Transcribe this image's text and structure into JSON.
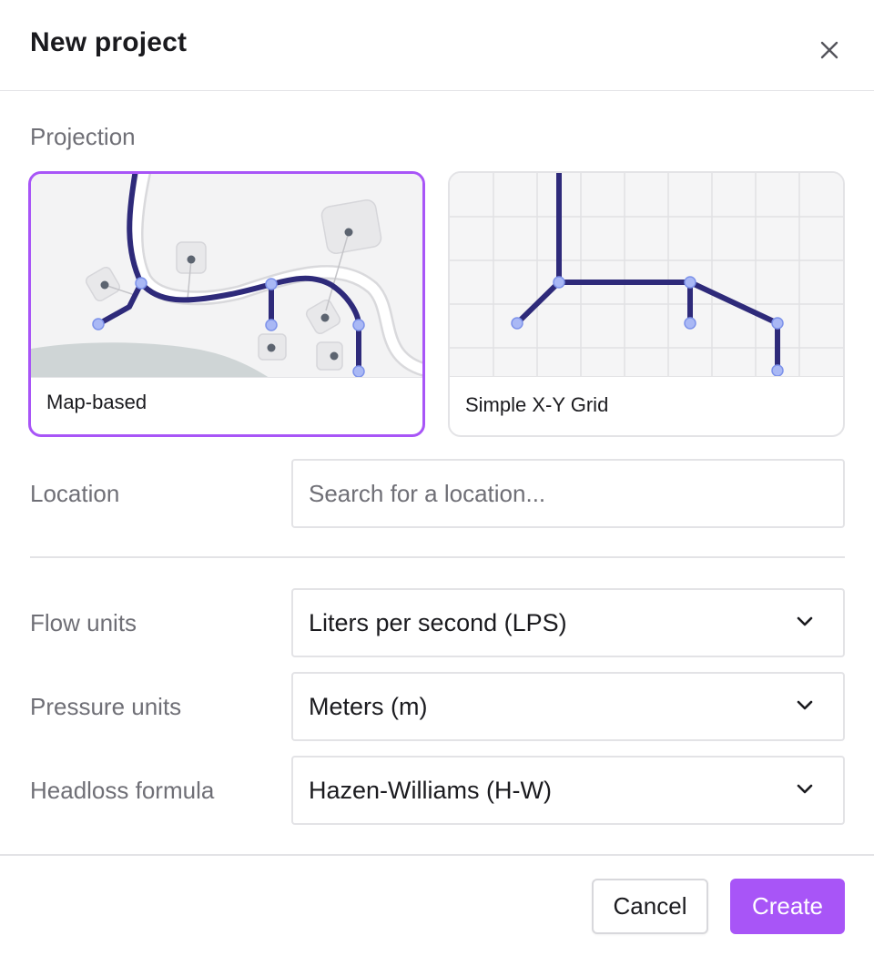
{
  "dialog": {
    "title": "New project",
    "close_icon": "close-icon"
  },
  "projection": {
    "label": "Projection",
    "options": [
      {
        "label": "Map-based",
        "selected": true,
        "illustration": "map-network-illustration"
      },
      {
        "label": "Simple X-Y Grid",
        "selected": false,
        "illustration": "grid-network-illustration"
      }
    ]
  },
  "location": {
    "label": "Location",
    "placeholder": "Search for a location...",
    "value": ""
  },
  "flow_units": {
    "label": "Flow units",
    "value": "Liters per second (LPS)"
  },
  "pressure_units": {
    "label": "Pressure units",
    "value": "Meters (m)"
  },
  "headloss_formula": {
    "label": "Headloss formula",
    "value": "Hazen-Williams (H-W)"
  },
  "footer": {
    "cancel_label": "Cancel",
    "create_label": "Create"
  },
  "colors": {
    "accent": "#a855f7",
    "pipe": "#2e2a7a",
    "node": "#a9b8f5",
    "border": "#e3e3e6"
  }
}
